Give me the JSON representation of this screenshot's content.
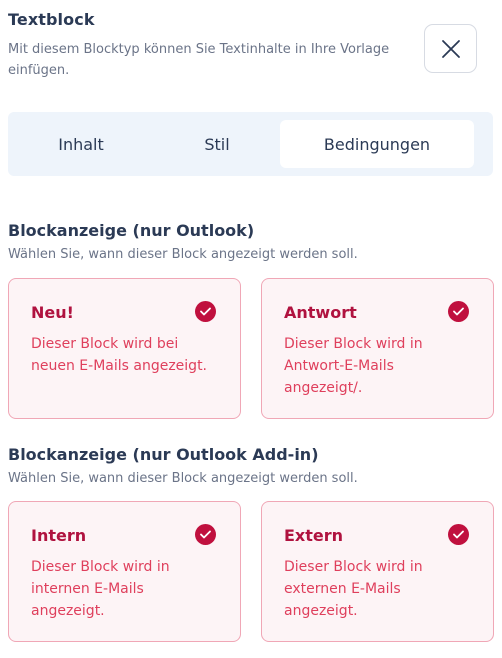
{
  "header": {
    "title": "Textblock",
    "subtitle": "Mit diesem Blocktyp können Sie Textinhalte in Ihre Vorlage einfügen."
  },
  "tabs": [
    {
      "label": "Inhalt",
      "active": false
    },
    {
      "label": "Stil",
      "active": false
    },
    {
      "label": "Bedingungen",
      "active": true
    }
  ],
  "sections": [
    {
      "title": "Blockanzeige (nur Outlook)",
      "subtitle": "Wählen Sie, wann dieser Block angezeigt werden soll.",
      "cards": [
        {
          "title": "Neu!",
          "description": "Dieser Block wird bei neuen E-Mails angezeigt.",
          "checked": true
        },
        {
          "title": "Antwort",
          "description": "Dieser Block wird in Antwort-E-Mails angezeigt/.",
          "checked": true
        }
      ]
    },
    {
      "title": "Blockanzeige (nur Outlook Add-in)",
      "subtitle": "Wählen Sie, wann dieser Block angezeigt werden soll.",
      "cards": [
        {
          "title": "Intern",
          "description": "Dieser Block wird in internen E-Mails angezeigt.",
          "checked": true
        },
        {
          "title": "Extern",
          "description": "Dieser Block wird in externen E-Mails angezeigt.",
          "checked": true
        }
      ]
    }
  ],
  "icons": {
    "close": "close-icon",
    "check": "check-circle-icon"
  },
  "colors": {
    "accent": "#c0103e",
    "card_background": "#fdf4f6",
    "card_border": "#f0a7b6",
    "tab_bar_background": "#eef4fb"
  }
}
